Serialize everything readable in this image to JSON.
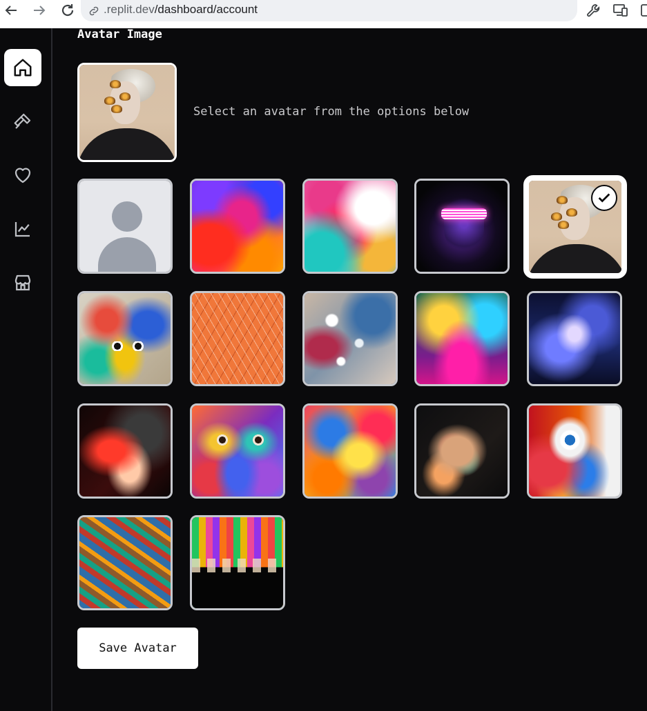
{
  "browser": {
    "url_prefix": ".replit.dev",
    "url_path": "/dashboard/account"
  },
  "sidebar": {
    "items": [
      {
        "name": "home",
        "icon": "home-icon",
        "active": true
      },
      {
        "name": "tools",
        "icon": "hammer-icon",
        "active": false
      },
      {
        "name": "favorites",
        "icon": "heart-icon",
        "active": false
      },
      {
        "name": "analytics",
        "icon": "chart-line-icon",
        "active": false
      },
      {
        "name": "store",
        "icon": "store-icon",
        "active": false
      }
    ]
  },
  "avatar_section": {
    "title": "Avatar Image",
    "instruction": "Select an avatar from the options below",
    "current_avatar": "butterfly-portrait",
    "options": [
      {
        "id": "default-silhouette",
        "selected": false
      },
      {
        "id": "ink-swirl-purple-red",
        "selected": false
      },
      {
        "id": "ink-swirl-pink-teal",
        "selected": false
      },
      {
        "id": "neon-glasses-portrait",
        "selected": false
      },
      {
        "id": "butterfly-portrait",
        "selected": true
      },
      {
        "id": "graffiti-face",
        "selected": false
      },
      {
        "id": "orange-leaf-pattern",
        "selected": false
      },
      {
        "id": "paint-drops",
        "selected": false
      },
      {
        "id": "rainbow-smoke-portrait",
        "selected": false
      },
      {
        "id": "galaxy-portrait",
        "selected": false
      },
      {
        "id": "red-light-portrait",
        "selected": false
      },
      {
        "id": "painted-face-hands",
        "selected": false
      },
      {
        "id": "paint-covered-hand",
        "selected": false
      },
      {
        "id": "face-paint-portrait",
        "selected": false
      },
      {
        "id": "painted-blue-eye",
        "selected": false
      },
      {
        "id": "paint-brushes",
        "selected": false
      },
      {
        "id": "colored-pencils",
        "selected": false
      }
    ],
    "save_label": "Save Avatar"
  },
  "colors": {
    "background": "#0a0a0c",
    "tile_border": "#c7c9ce",
    "selected_border": "#ffffff",
    "button_bg": "#ffffff"
  }
}
